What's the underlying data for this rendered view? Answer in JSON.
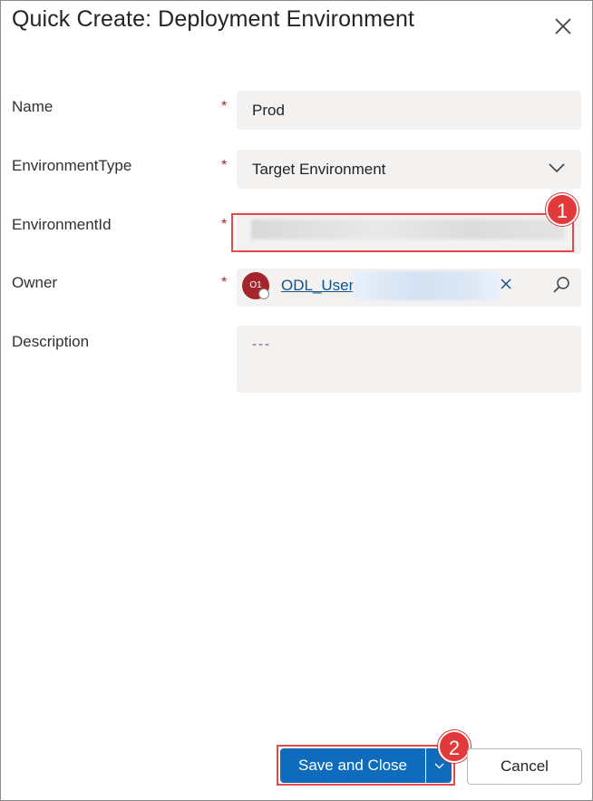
{
  "dialog": {
    "title": "Quick Create: Deployment Environment"
  },
  "fields": {
    "name": {
      "label": "Name",
      "required_marker": "*",
      "value": "Prod"
    },
    "environment_type": {
      "label": "EnvironmentType",
      "required_marker": "*",
      "value": "Target Environment"
    },
    "environment_id": {
      "label": "EnvironmentId",
      "required_marker": "*",
      "value": ""
    },
    "owner": {
      "label": "Owner",
      "required_marker": "*",
      "initials": "O1",
      "value": "ODL_User"
    },
    "description": {
      "label": "Description",
      "placeholder": "---"
    }
  },
  "annotations": {
    "step1": "1",
    "step2": "2"
  },
  "buttons": {
    "save_and_close": "Save and Close",
    "cancel": "Cancel"
  },
  "colors": {
    "primary": "#0f6cbd",
    "required": "#a4262c",
    "highlight": "#e5484d",
    "link": "#0f548c"
  },
  "icons": [
    "close-icon",
    "chevron-down-icon",
    "remove-icon",
    "search-icon",
    "split-chevron-icon"
  ]
}
